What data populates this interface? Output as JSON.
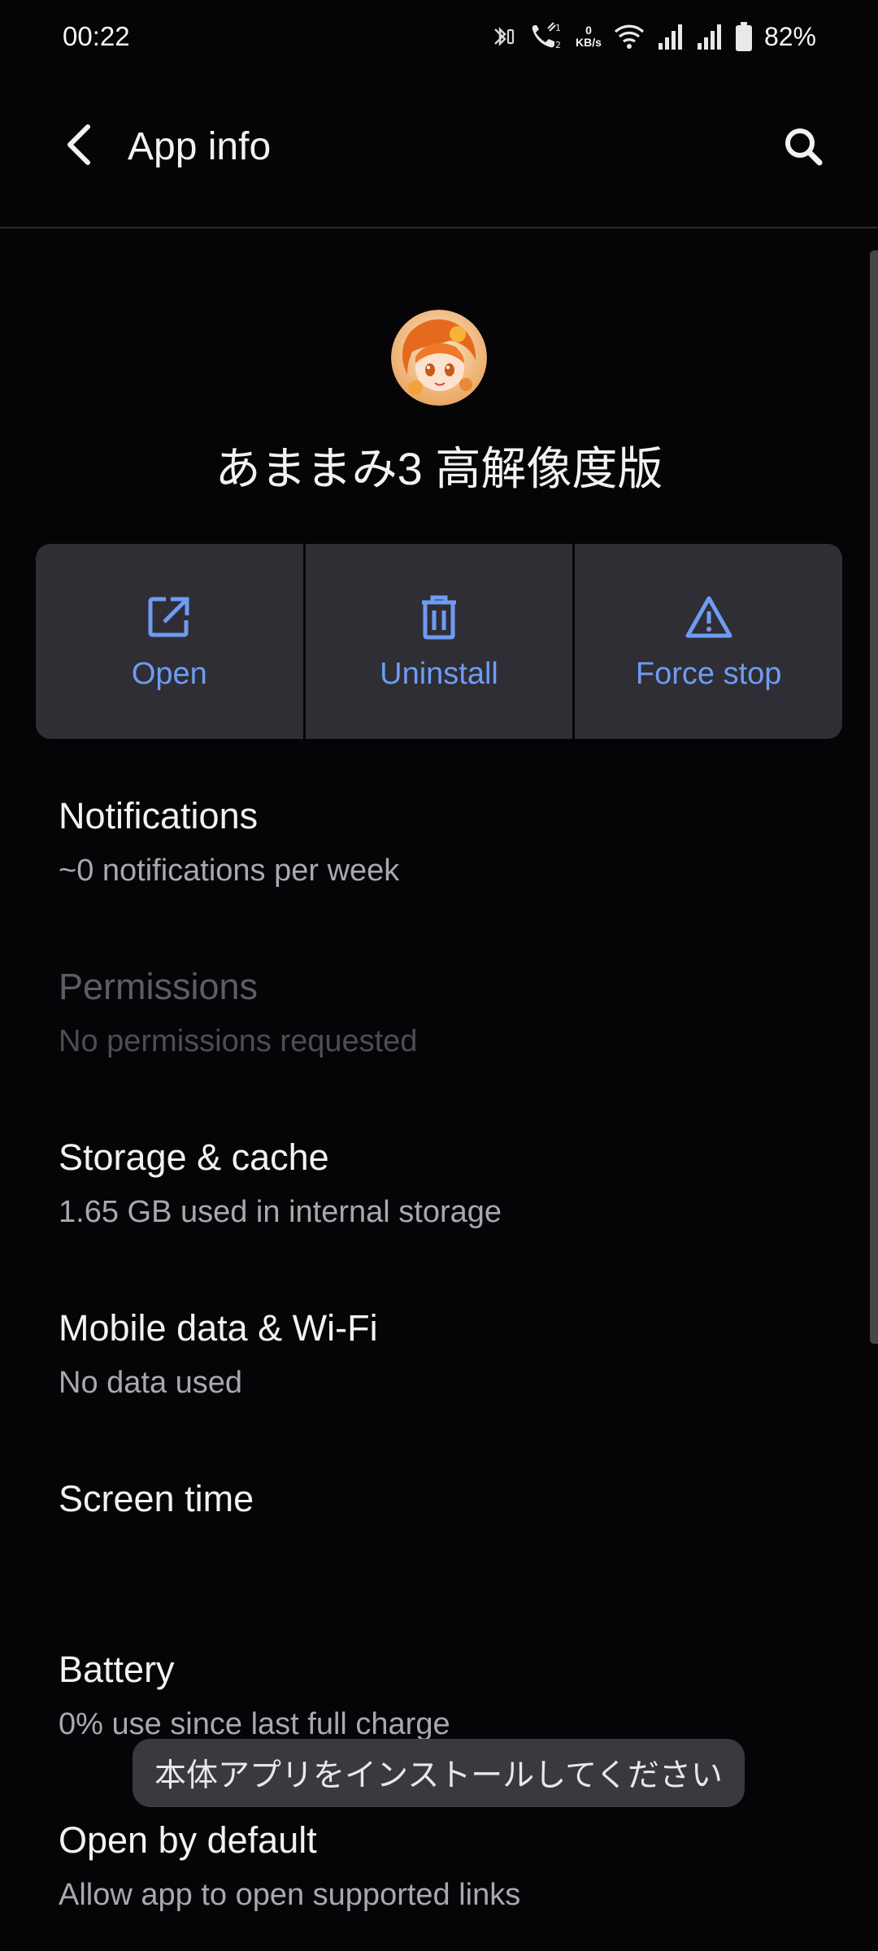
{
  "status_bar": {
    "time": "00:22",
    "net_speed_value": "0",
    "net_speed_unit": "KB/s",
    "battery_percent": "82%"
  },
  "app_bar": {
    "title": "App info"
  },
  "header": {
    "app_name": "あままみ3 高解像度版"
  },
  "actions": {
    "open_label": "Open",
    "uninstall_label": "Uninstall",
    "force_stop_label": "Force stop"
  },
  "settings": {
    "notifications": {
      "title": "Notifications",
      "subtitle": "~0 notifications per week"
    },
    "permissions": {
      "title": "Permissions",
      "subtitle": "No permissions requested"
    },
    "storage": {
      "title": "Storage & cache",
      "subtitle": "1.65 GB used in internal storage"
    },
    "mobile_data": {
      "title": "Mobile data & Wi-Fi",
      "subtitle": "No data used"
    },
    "screen_time": {
      "title": "Screen time"
    },
    "battery": {
      "title": "Battery",
      "subtitle": "0% use since last full charge"
    },
    "open_by_default": {
      "title": "Open by default",
      "subtitle": "Allow app to open supported links"
    }
  },
  "toast": {
    "message": "本体アプリをインストールしてください"
  },
  "colors": {
    "background": "#050407",
    "accent": "#6f9bf2",
    "button_surface": "#2f2e34",
    "toast_surface": "#3a393e"
  },
  "icons": {
    "back": "arrow-back-icon",
    "search": "search-icon",
    "open": "open-external-icon",
    "uninstall": "trash-icon",
    "force_stop": "warning-icon"
  }
}
